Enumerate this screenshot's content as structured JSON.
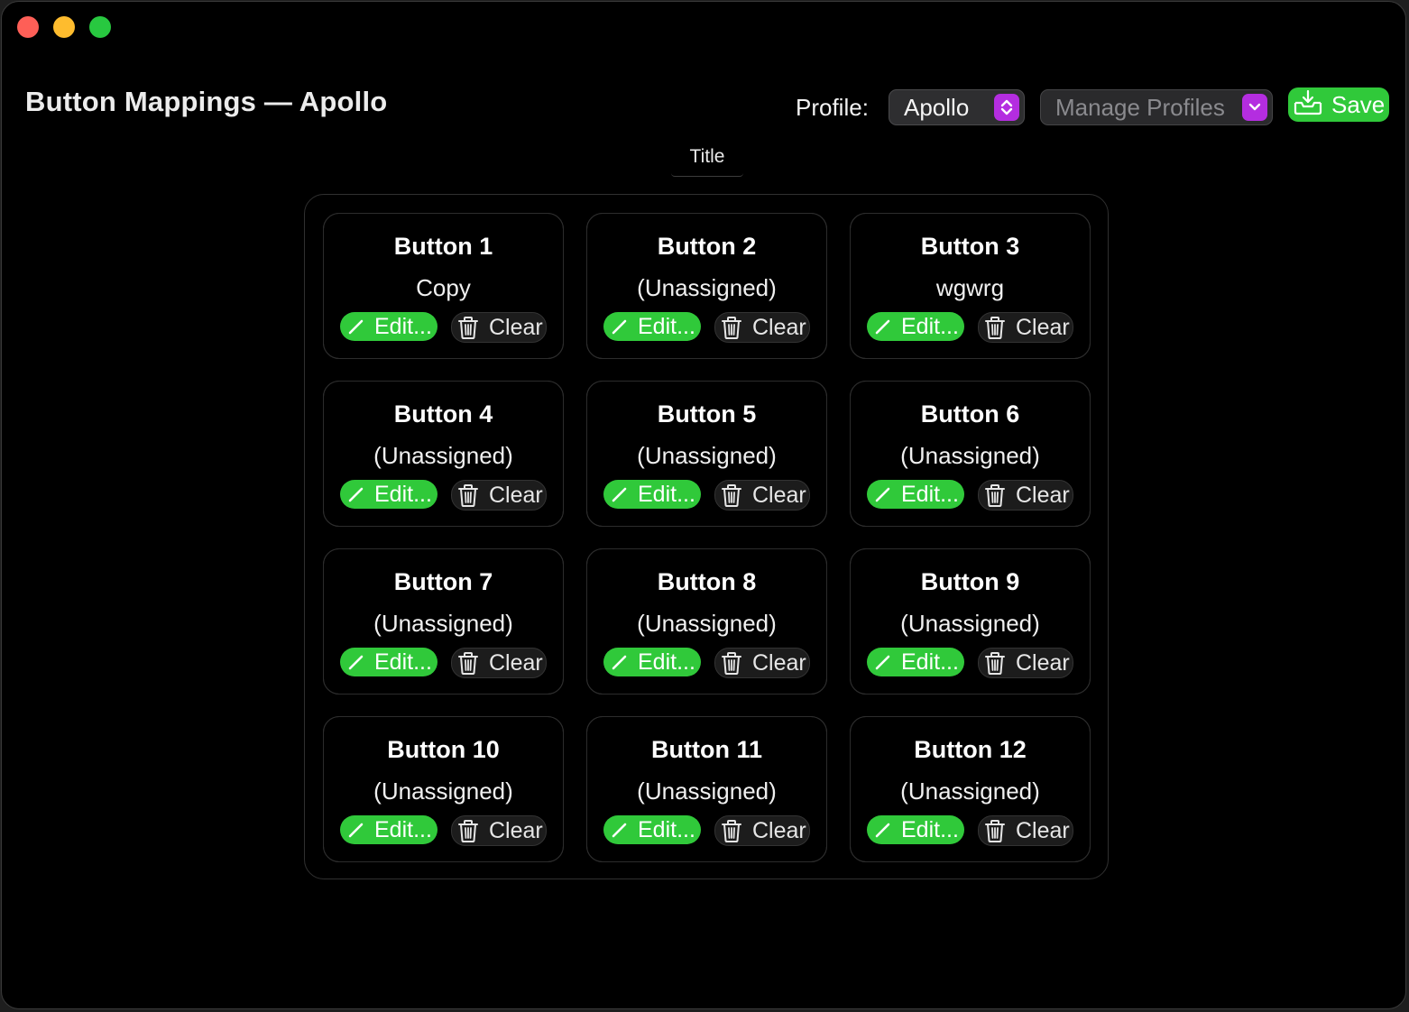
{
  "window": {
    "title": "Button Mappings — Apollo"
  },
  "toolbar": {
    "profile_label": "Profile:",
    "profile_value": "Apollo",
    "manage_profiles": "Manage Profiles",
    "save_label": "Save"
  },
  "group": {
    "title": "Title"
  },
  "buttons": [
    {
      "name": "Button 1",
      "action": "Copy"
    },
    {
      "name": "Button 2",
      "action": "(Unassigned)"
    },
    {
      "name": "Button 3",
      "action": "wgwrg"
    },
    {
      "name": "Button 4",
      "action": "(Unassigned)"
    },
    {
      "name": "Button 5",
      "action": "(Unassigned)"
    },
    {
      "name": "Button 6",
      "action": "(Unassigned)"
    },
    {
      "name": "Button 7",
      "action": "(Unassigned)"
    },
    {
      "name": "Button 8",
      "action": "(Unassigned)"
    },
    {
      "name": "Button 9",
      "action": "(Unassigned)"
    },
    {
      "name": "Button 10",
      "action": "(Unassigned)"
    },
    {
      "name": "Button 11",
      "action": "(Unassigned)"
    },
    {
      "name": "Button 12",
      "action": "(Unassigned)"
    }
  ],
  "labels": {
    "edit": "Edit...",
    "clear": "Clear"
  },
  "icons": {
    "edit": "pencil-icon",
    "clear": "trash-icon",
    "save": "tray-download-icon",
    "stepper": "chevron-up-down-icon",
    "dropdown": "chevron-down-icon"
  },
  "colors": {
    "accent_green": "#30c93a",
    "popup_accent": "#b42de0",
    "background": "#000000"
  }
}
